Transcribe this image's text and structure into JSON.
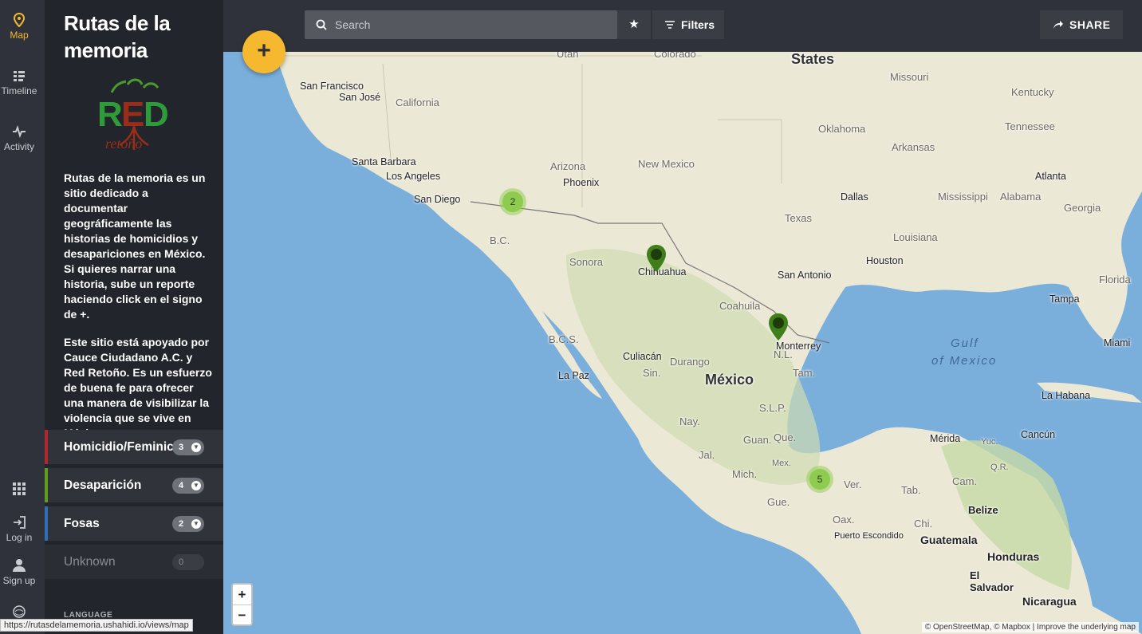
{
  "nav": {
    "map": "Map",
    "timeline": "Timeline",
    "activity": "Activity",
    "login": "Log in",
    "signup": "Sign up"
  },
  "sidebar": {
    "title": "Rutas de la memoria",
    "logo_text": "RED retoño",
    "description": [
      "Rutas de la memoria es un sitio dedicado a documentar geográficamente las historias de homicidios y desapariciones en México. Si quieres narrar una historia, sube un reporte haciendo click en el signo de +.",
      "Este sitio está apoyado por Cauce Ciudadano A.C. y Red Retoño. Es un esfuerzo de buena fe para ofrecer una manera de visibilizar la violencia que se vive en México."
    ],
    "categories": [
      {
        "label": "Homicidio/Feminicidio",
        "count": "3",
        "color": "#b0272d"
      },
      {
        "label": "Desaparición",
        "count": "4",
        "color": "#5f9e1c"
      },
      {
        "label": "Fosas",
        "count": "2",
        "color": "#2e6fb5"
      },
      {
        "label": "Unknown",
        "count": "0",
        "color": ""
      }
    ],
    "language_label": "LANGUAGE"
  },
  "toolbar": {
    "search_placeholder": "Search",
    "filters_label": "Filters",
    "share_label": "SHARE"
  },
  "map": {
    "add_label": "+",
    "zoom_in": "+",
    "zoom_out": "−",
    "attribution": "© OpenStreetMap, © Mapbox | Improve the underlying map",
    "clusters": [
      "2",
      "5"
    ],
    "labels": {
      "states": "States",
      "mexico": "México",
      "gulf1": "Gulf",
      "gulf2": "of Mexico",
      "cities": [
        "San Francisco",
        "San José",
        "Santa Barbara",
        "Los Angeles",
        "San Diego",
        "Phoenix",
        "Dallas",
        "Houston",
        "San Antonio",
        "Chihuahua",
        "Monterrey",
        "Culiacán",
        "La Paz",
        "Atlanta",
        "Tampa",
        "Miami",
        "La Habana",
        "Mérida",
        "Cancún",
        "Belize",
        "Guatemala",
        "Honduras",
        "El Salvador",
        "Nicaragua",
        "Puerto Escondido"
      ],
      "regions": [
        "California",
        "Arizona",
        "New Mexico",
        "Oklahoma",
        "Arkansas",
        "Texas",
        "Louisiana",
        "Missouri",
        "Kentucky",
        "Tennessee",
        "Mississippi",
        "Alabama",
        "Georgia",
        "Florida",
        "Sonora",
        "Coahuila",
        "Durango",
        "B.C.",
        "B.C.S.",
        "Sin.",
        "N.L.",
        "Tam.",
        "Nay.",
        "Jal.",
        "Guan.",
        "Que.",
        "Mich.",
        "Gue.",
        "Oax.",
        "Ver.",
        "Tab.",
        "Chi.",
        "Cam.",
        "Q.R.",
        "Yuc.",
        "S.L.P.",
        "Mex.",
        "Utah",
        "Colorado"
      ]
    }
  },
  "status_url": "https://rutasdelamemoria.ushahidi.io/views/map",
  "colors": {
    "accent": "#f5b82e",
    "marker": "#3f7f1a",
    "cluster": "#8ecb4f"
  }
}
